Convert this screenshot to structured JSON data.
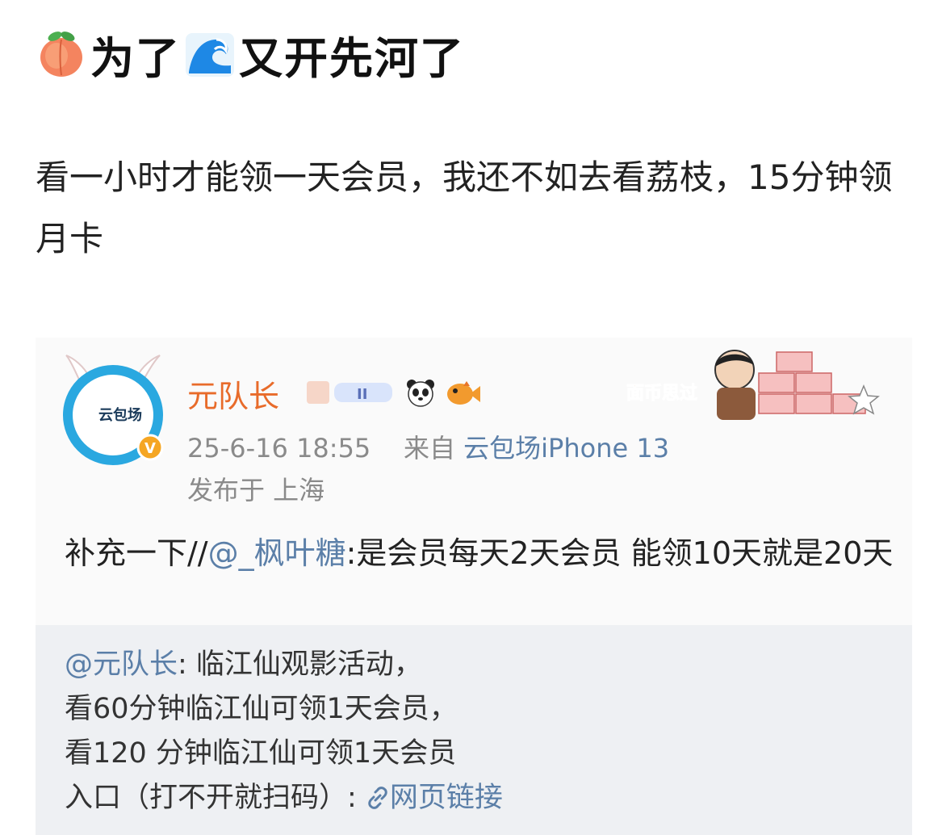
{
  "post": {
    "title_parts": [
      "为了",
      "又开先河了"
    ],
    "title_emoji_1": "peach-emoji",
    "title_emoji_2": "wave-emoji",
    "body": "看一小时才能领一天会员，我还不如去看荔枝，15分钟领月卡"
  },
  "repost": {
    "username": "元队长",
    "avatar_label": "云包场",
    "verified_mark": "V",
    "badge_text": "II",
    "sticker_text": "面币思过",
    "timestamp": "25-6-16 18:55",
    "from_label": "来自",
    "source": "云包场iPhone 13",
    "location": "发布于 上海",
    "text_prefix": "补充一下//",
    "mention": "@_枫叶糖",
    "text_suffix": ":是会员每天2天会员 能领10天就是20天"
  },
  "quoted": {
    "mention": "@元队长",
    "line1": ": 临江仙观影活动，",
    "line2": "看60分钟临江仙可领1天会员，",
    "line3": "看120 分钟临江仙可领1天会员",
    "line4_prefix": "入口（打不开就扫码）: ",
    "link_text": "网页链接"
  },
  "colors": {
    "username": "#e86b2a",
    "link": "#5b7fa8",
    "meta": "#8a8a8a",
    "quoted_bg": "#eef0f3"
  }
}
